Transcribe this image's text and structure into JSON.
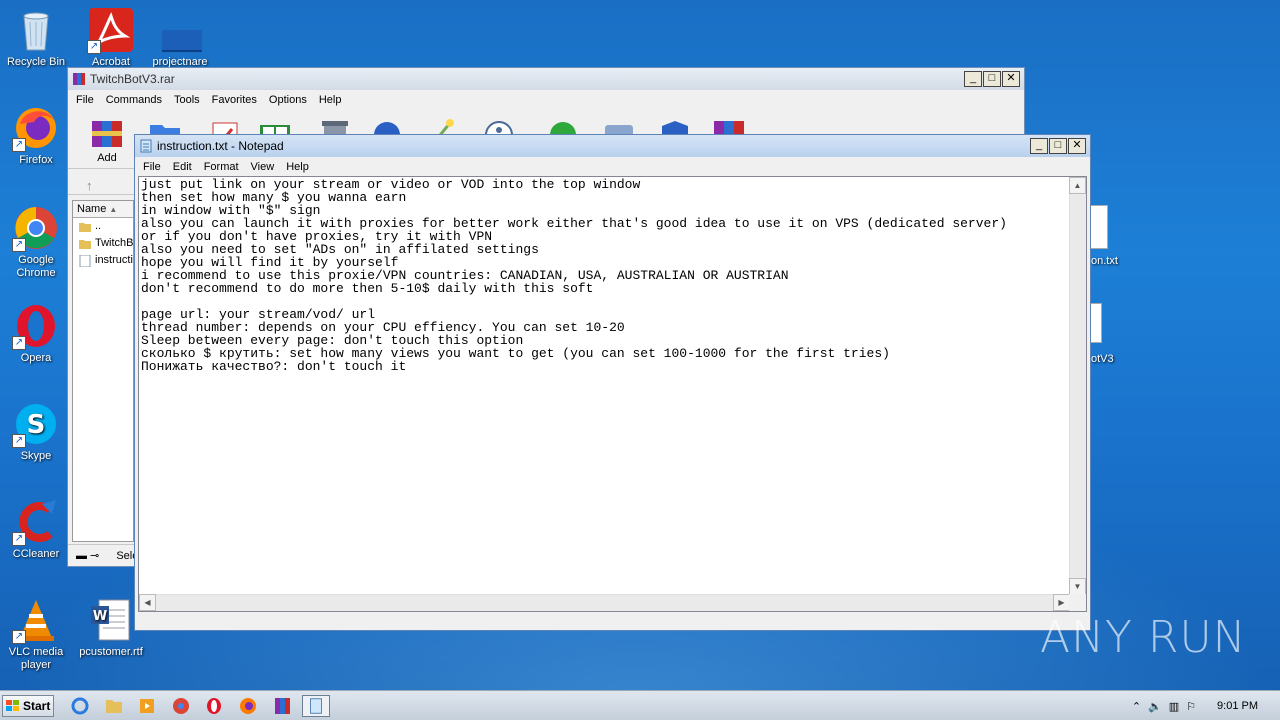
{
  "desktop": {
    "icons": [
      {
        "label": "Recycle Bin"
      },
      {
        "label": "Acrobat"
      },
      {
        "label": "projectnare"
      },
      {
        "label": "Firefox"
      },
      {
        "label": "Google Chrome"
      },
      {
        "label": "Opera"
      },
      {
        "label": "Skype"
      },
      {
        "label": "CCleaner"
      },
      {
        "label": "VLC media player"
      },
      {
        "label": "pcustomer.rtf"
      }
    ],
    "peek_labels": [
      "on.txt",
      "otV3"
    ],
    "watermark": "ANY RUN"
  },
  "winrar": {
    "title": "TwitchBotV3.rar",
    "menu": [
      "File",
      "Commands",
      "Tools",
      "Favorites",
      "Options",
      "Help"
    ],
    "add_label": "Add",
    "column_name": "Name",
    "files": [
      "..",
      "TwitchBo",
      "instructi"
    ],
    "status": "Sele"
  },
  "notepad": {
    "title": "instruction.txt - Notepad",
    "menu": [
      "File",
      "Edit",
      "Format",
      "View",
      "Help"
    ],
    "content": "just put link on your stream or video or VOD into the top window\nthen set how many $ you wanna earn\nin window with \"$\" sign\nalso you can launch it with proxies for better work either that's good idea to use it on VPS (dedicated server)\nor if you don't have proxies, try it with VPN\nalso you need to set \"ADs on\" in affilated settings\nhope you will find it by yourself\ni recommend to use this proxie/VPN countries: CANADIAN, USA, AUSTRALIAN OR AUSTRIAN\ndon't recommend to do more then 5-10$ daily with this soft\n\npage url: your stream/vod/ url\nthread number: depends on your CPU effiency. You can set 10-20\nSleep between every page: don't touch this option\nсколько $ крутить: set how many views you want to get (you can set 100-1000 for the first tries)\nПонижать качество?: don't touch it"
  },
  "taskbar": {
    "start_label": "Start",
    "clock": "9:01 PM"
  }
}
